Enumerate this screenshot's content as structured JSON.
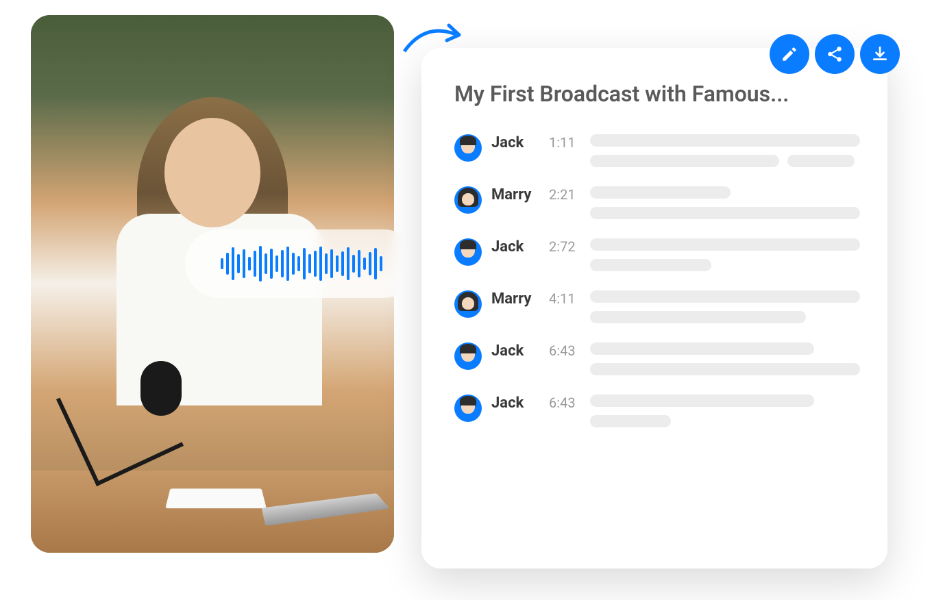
{
  "transcript": {
    "title": "My First Broadcast with Famous...",
    "entries": [
      {
        "speaker": "Jack",
        "gender": "m",
        "time": "1:11",
        "lines": [
          [
            100
          ],
          [
            70,
            25
          ]
        ]
      },
      {
        "speaker": "Marry",
        "gender": "f",
        "time": "2:21",
        "lines": [
          [
            52
          ],
          [
            100
          ]
        ]
      },
      {
        "speaker": "Jack",
        "gender": "m",
        "time": "2:72",
        "lines": [
          [
            100
          ],
          [
            45
          ]
        ]
      },
      {
        "speaker": "Marry",
        "gender": "f",
        "time": "4:11",
        "lines": [
          [
            100
          ],
          [
            80
          ]
        ]
      },
      {
        "speaker": "Jack",
        "gender": "m",
        "time": "6:43",
        "lines": [
          [
            83
          ],
          [
            100
          ]
        ]
      },
      {
        "speaker": "Jack",
        "gender": "m",
        "time": "6:43",
        "lines": [
          [
            83
          ],
          [
            30
          ]
        ]
      }
    ]
  },
  "actions": {
    "edit": "edit",
    "share": "share",
    "download": "download"
  },
  "colors": {
    "primary": "#0a7cff",
    "placeholder": "#ececec"
  }
}
